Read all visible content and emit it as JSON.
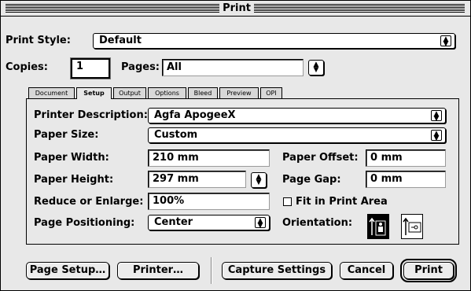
{
  "window": {
    "title": "Print"
  },
  "print_style": {
    "label": "Print Style:",
    "value": "Default"
  },
  "copies": {
    "label": "Copies:",
    "value": "1"
  },
  "pages": {
    "label": "Pages:",
    "value": "All"
  },
  "tabs": [
    {
      "label": "Document",
      "active": false
    },
    {
      "label": "Setup",
      "active": true
    },
    {
      "label": "Output",
      "active": false
    },
    {
      "label": "Options",
      "active": false
    },
    {
      "label": "Bleed",
      "active": false
    },
    {
      "label": "Preview",
      "active": false
    },
    {
      "label": "OPI",
      "active": false
    }
  ],
  "setup": {
    "printer_description": {
      "label": "Printer Description:",
      "value": "Agfa ApogeeX"
    },
    "paper_size": {
      "label": "Paper Size:",
      "value": "Custom"
    },
    "paper_width": {
      "label": "Paper Width:",
      "value": "210  mm"
    },
    "paper_height": {
      "label": "Paper Height:",
      "value": "297  mm"
    },
    "reduce_enlarge": {
      "label": "Reduce or Enlarge:",
      "value": "100%"
    },
    "page_positioning": {
      "label": "Page Positioning:",
      "value": "Center"
    },
    "paper_offset": {
      "label": "Paper Offset:",
      "value": "0  mm"
    },
    "page_gap": {
      "label": "Page Gap:",
      "value": "0  mm"
    },
    "fit_in_print_area": {
      "label": "Fit in Print Area",
      "checked": false
    },
    "orientation": {
      "label": "Orientation:",
      "selected": "portrait"
    }
  },
  "buttons": {
    "page_setup": "Page Setup…",
    "printer": "Printer…",
    "capture_settings": "Capture Settings",
    "cancel": "Cancel",
    "print": "Print"
  }
}
